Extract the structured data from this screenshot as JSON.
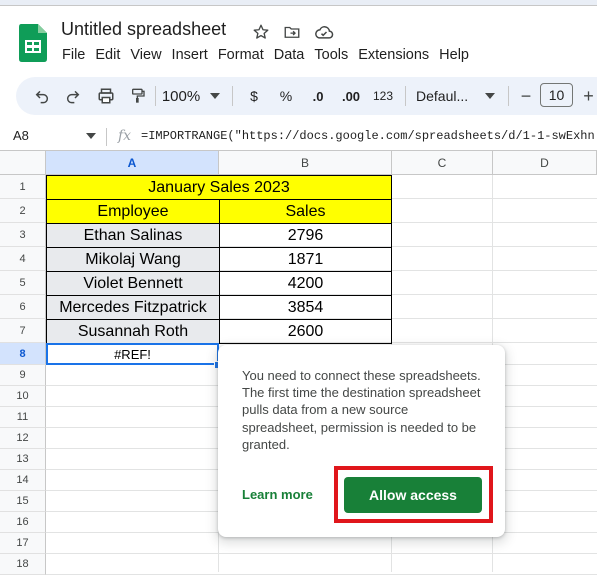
{
  "document": {
    "title": "Untitled spreadsheet"
  },
  "menu": [
    "File",
    "Edit",
    "View",
    "Insert",
    "Format",
    "Data",
    "Tools",
    "Extensions",
    "Help"
  ],
  "toolbar": {
    "zoom": "100%",
    "currency": "$",
    "percent": "%",
    "decrease_decimal": ".0",
    "increase_decimal": ".00",
    "number_format": "123",
    "font": "Defaul...",
    "font_size": "10",
    "minus": "−",
    "plus": "+"
  },
  "formula_bar": {
    "cell_ref": "A8",
    "fx": "fx",
    "formula": "=IMPORTRANGE(\"https://docs.google.com/spreadsheets/d/1-1-swExhn"
  },
  "columns": [
    "A",
    "B",
    "C",
    "D"
  ],
  "rows": [
    "1",
    "2",
    "3",
    "4",
    "5",
    "6",
    "7",
    "8",
    "9",
    "10",
    "11",
    "12",
    "13",
    "14",
    "15",
    "16",
    "17",
    "18"
  ],
  "sheet": {
    "title": "January Sales 2023",
    "headers": [
      "Employee",
      "Sales"
    ],
    "records": [
      {
        "employee": "Ethan Salinas",
        "sales": "2796"
      },
      {
        "employee": "Mikolaj Wang",
        "sales": "1871"
      },
      {
        "employee": "Violet Bennett",
        "sales": "4200"
      },
      {
        "employee": "Mercedes Fitzpatrick",
        "sales": "3854"
      },
      {
        "employee": "Susannah Roth",
        "sales": "2600"
      }
    ],
    "a8": "#REF!"
  },
  "popup": {
    "message": "You need to connect these spreadsheets. The first time the destination spreadsheet pulls data from a new source spreadsheet, permission is needed to be granted.",
    "learn_more": "Learn more",
    "allow_access": "Allow access"
  },
  "colors": {
    "header_fill": "#ffff00",
    "name_fill": "#e8eaed",
    "accent_green": "#188038",
    "highlight_red": "#e0161b",
    "selection_blue": "#1a73e8"
  },
  "icons": [
    "sheets-logo-icon",
    "star-icon",
    "move-folder-icon",
    "cloud-saved-icon",
    "undo-icon",
    "redo-icon",
    "print-icon",
    "paint-format-icon",
    "chevron-down-icon",
    "fx-icon"
  ]
}
